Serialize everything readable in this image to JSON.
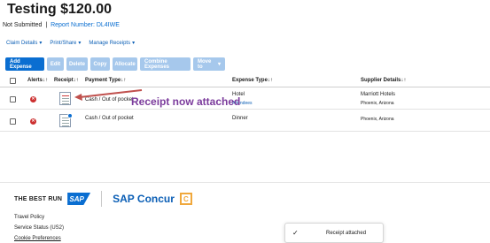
{
  "report": {
    "title": "Testing $120.00",
    "status": "Not Submitted",
    "separator": "|",
    "report_number_label": "Report Number: DL4IWE"
  },
  "menus": [
    {
      "label": "Claim Details"
    },
    {
      "label": "Print/Share"
    },
    {
      "label": "Manage Receipts"
    }
  ],
  "toolbar": {
    "add_expense": "Add Expense",
    "edit": "Edit",
    "delete": "Delete",
    "copy": "Copy",
    "allocate": "Allocate",
    "combine": "Combine Expenses",
    "move_to": "Move to"
  },
  "table": {
    "headers": {
      "alerts": "Alerts↓↑",
      "receipt": "Receipt↓↑",
      "payment": "Payment Type↓↑",
      "expense": "Expense Type↓↑",
      "supplier": "Supplier Details↓↑"
    },
    "rows": [
      {
        "payment": "Cash / Out of pocket",
        "expense": "Hotel",
        "attendees": "Attendees",
        "supplier": "Marriott Hotels",
        "location": "Phoenix, Arizona"
      },
      {
        "payment": "Cash / Out of pocket",
        "expense": "Dinner",
        "attendees": "",
        "supplier": "",
        "location": "Phoenix, Arizona"
      }
    ]
  },
  "annotation": "Receipt now attached",
  "footer": {
    "tagline": "THE BEST RUN",
    "sap": "SAP",
    "concur": "SAP Concur",
    "concur_mark": "C",
    "links": [
      "Travel Policy",
      "Service Status (US2)",
      "Cookie Preferences"
    ]
  },
  "toast": {
    "message": "Receipt attached",
    "check": "✓"
  },
  "colors": {
    "accent": "#0a6ed1",
    "annotation": "#7b3b9c",
    "error": "#cc2f2f",
    "concur_orange": "#f0a83c"
  }
}
